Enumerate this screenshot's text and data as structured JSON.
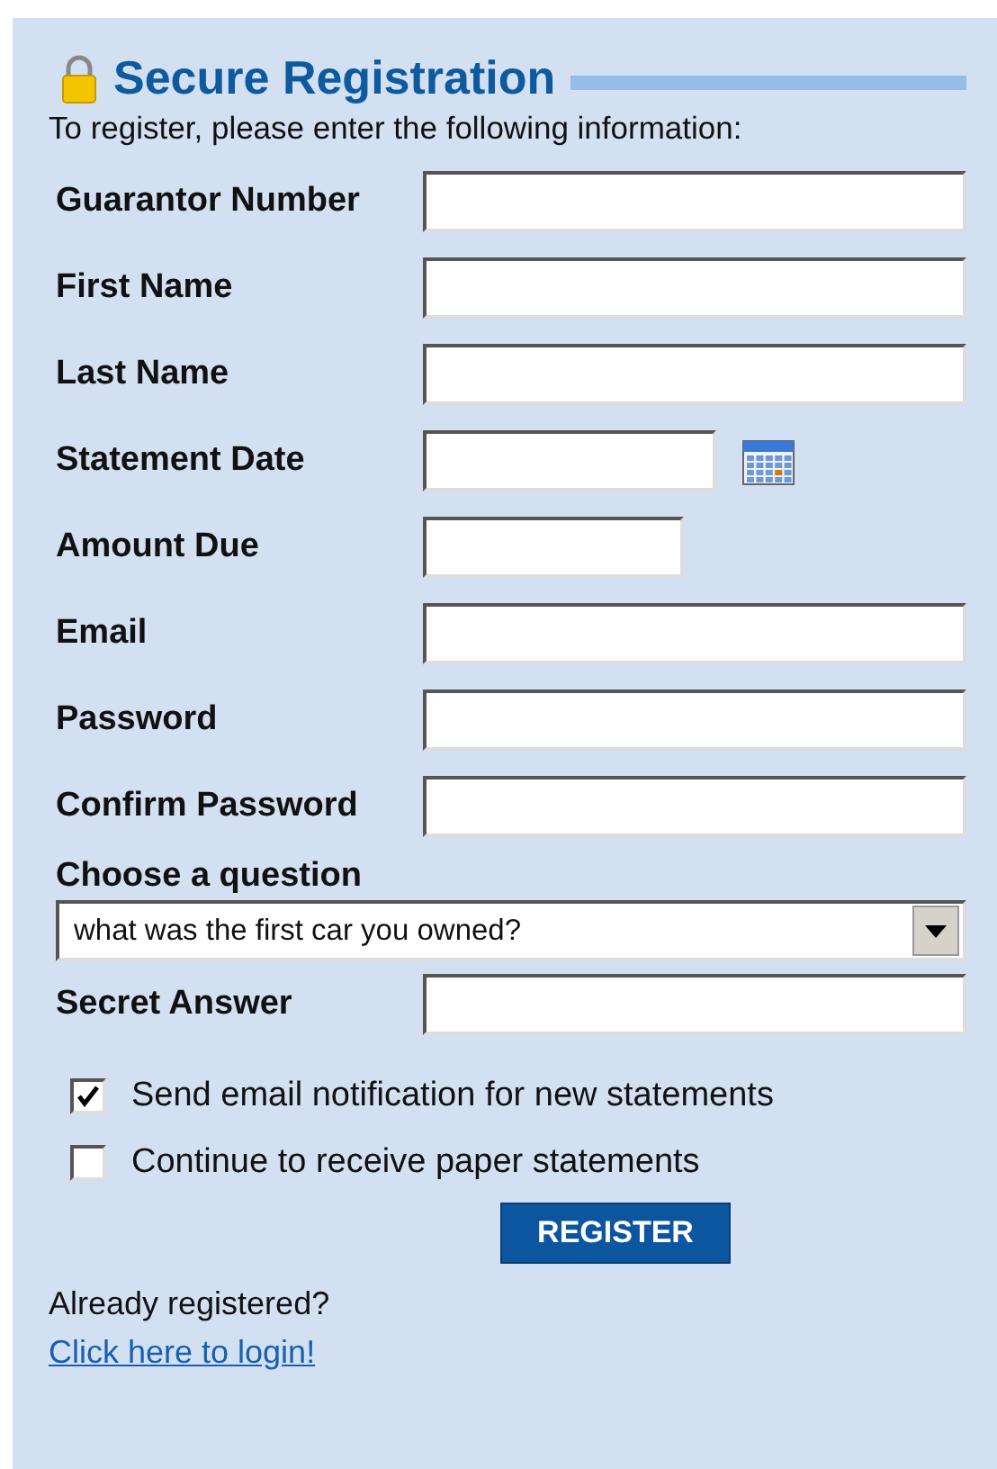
{
  "title": "Secure Registration",
  "intro": "To register, please enter the following information:",
  "fields": [
    {
      "label": "Guarantor Number",
      "kind": "text"
    },
    {
      "label": "First Name",
      "kind": "text"
    },
    {
      "label": "Last Name",
      "kind": "text"
    },
    {
      "label": "Statement Date",
      "kind": "date"
    },
    {
      "label": "Amount Due",
      "kind": "amount"
    },
    {
      "label": "Email",
      "kind": "text"
    },
    {
      "label": "Password",
      "kind": "text"
    },
    {
      "label": "Confirm Password",
      "kind": "text"
    }
  ],
  "question": {
    "label": "Choose a question",
    "value": "what was the first car you owned?"
  },
  "secret_answer": {
    "label": "Secret Answer"
  },
  "checkboxes": [
    {
      "label": "Send email notification for new statements",
      "checked": true
    },
    {
      "label": "Continue to receive paper statements",
      "checked": false
    }
  ],
  "register_button": "REGISTER",
  "login_prompt": "Already registered?",
  "login_link": "Click here to login!"
}
